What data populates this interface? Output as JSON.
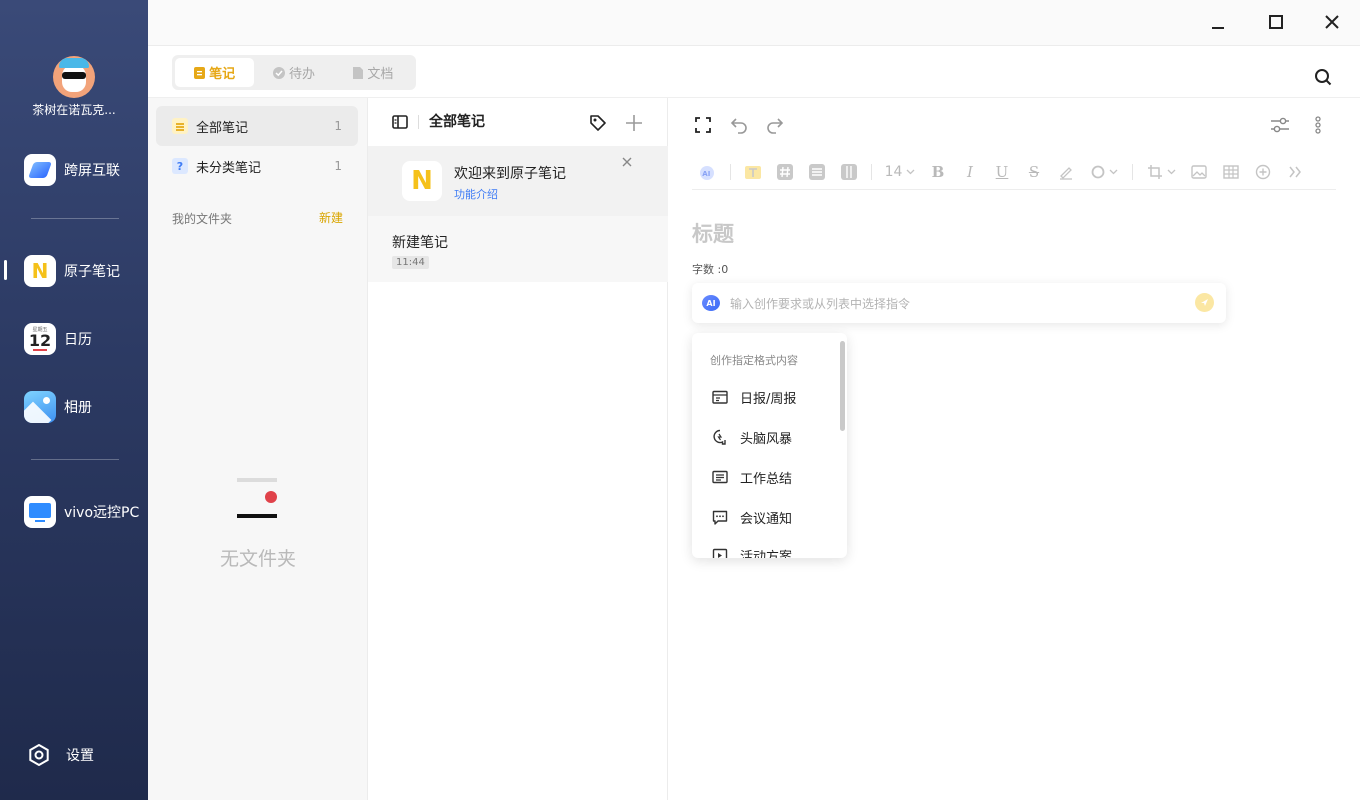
{
  "profile": {
    "name": "茶树在诺瓦克..."
  },
  "nav": {
    "items": [
      {
        "label": "跨屏互联",
        "icon": "kuaping-app-icon"
      },
      {
        "label": "原子笔记",
        "icon": "atom-notes-app-icon",
        "active": true
      },
      {
        "label": "日历",
        "icon": "calendar-app-icon",
        "month_label": "星期五",
        "day": "12"
      },
      {
        "label": "相册",
        "icon": "gallery-app-icon"
      },
      {
        "label": "vivo远控PC",
        "icon": "remote-pc-app-icon"
      }
    ],
    "settings_label": "设置"
  },
  "window": {
    "controls": [
      "minimize-icon",
      "maximize-icon",
      "close-icon"
    ]
  },
  "tabs": [
    {
      "label": "笔记",
      "active": true
    },
    {
      "label": "待办",
      "active": false
    },
    {
      "label": "文档",
      "active": false
    }
  ],
  "folders": {
    "items": [
      {
        "label": "全部笔记",
        "count": "1",
        "selected": true
      },
      {
        "label": "未分类笔记",
        "count": "1",
        "selected": false
      }
    ],
    "my_folders_label": "我的文件夹",
    "new_label": "新建",
    "empty_text": "无文件夹"
  },
  "notes": {
    "header": "全部笔记",
    "welcome": {
      "title": "欢迎来到原子笔记",
      "subtitle": "功能介绍",
      "logo": "N"
    },
    "items": [
      {
        "title": "新建笔记",
        "time": "11:44"
      }
    ]
  },
  "editor": {
    "title_placeholder": "标题",
    "word_count": "字数 :0",
    "font_size": "14",
    "ai_badge": "AI",
    "ai_placeholder": "输入创作要求或从列表中选择指令",
    "dropdown": {
      "heading": "创作指定格式内容",
      "items": [
        "日报/周报",
        "头脑风暴",
        "工作总结",
        "会议通知",
        "活动方案"
      ]
    }
  },
  "colors": {
    "sidebar": "#2c3a63",
    "accent": "#e6a817",
    "link": "#3f7cf5"
  }
}
